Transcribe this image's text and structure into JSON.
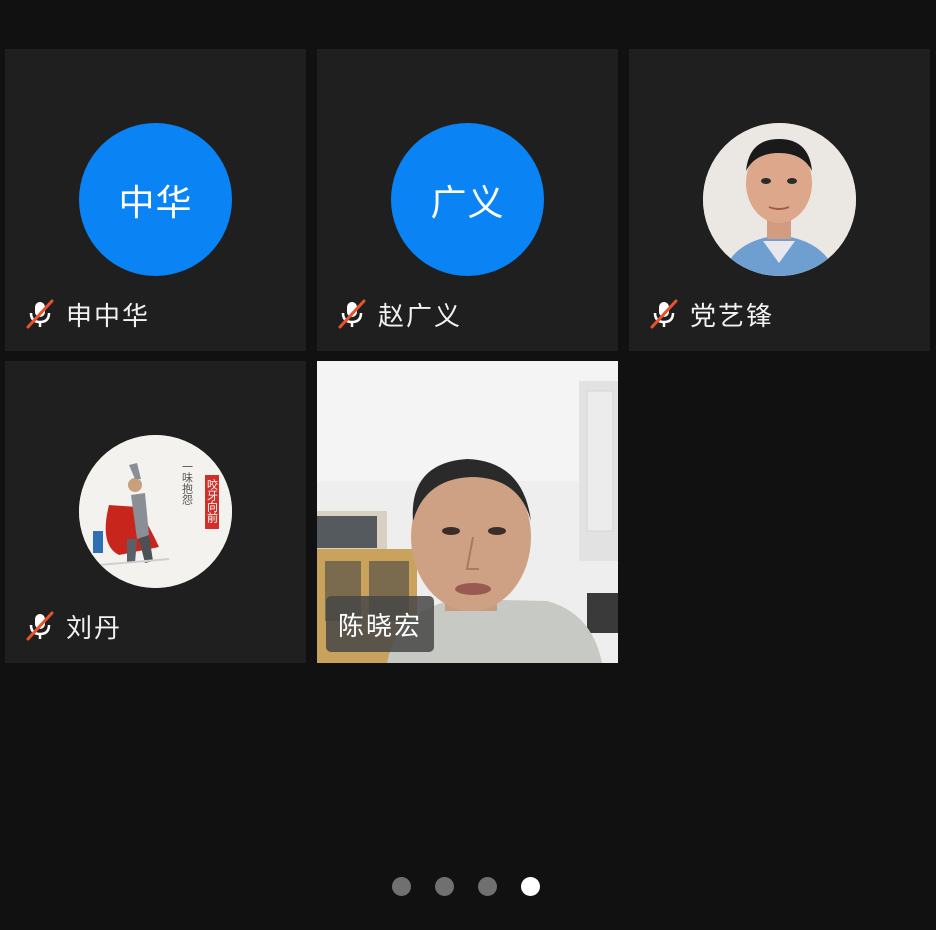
{
  "participants": [
    {
      "name": "申中华",
      "avatar_text": "中华",
      "avatar_type": "initials",
      "muted": true
    },
    {
      "name": "赵广义",
      "avatar_text": "广义",
      "avatar_type": "initials",
      "muted": true
    },
    {
      "name": "党艺锋",
      "avatar_type": "photo",
      "muted": true
    },
    {
      "name": "刘丹",
      "avatar_type": "photo",
      "muted": true
    },
    {
      "name": "陈晓宏",
      "avatar_type": "video",
      "muted": false
    }
  ],
  "poster_texts": {
    "line1": "一味抱怨",
    "line2": "咬牙向前"
  },
  "pager": {
    "total": 4,
    "active_index": 3
  },
  "colors": {
    "background": "#111111",
    "tile": "#1f1f1f",
    "avatar_blue": "#0a84f5",
    "mute_slash": "#e8522a",
    "pager_active": "#ffffff",
    "pager_inactive": "#707070"
  },
  "icons": {
    "muted_mic": "muted-mic-icon"
  }
}
